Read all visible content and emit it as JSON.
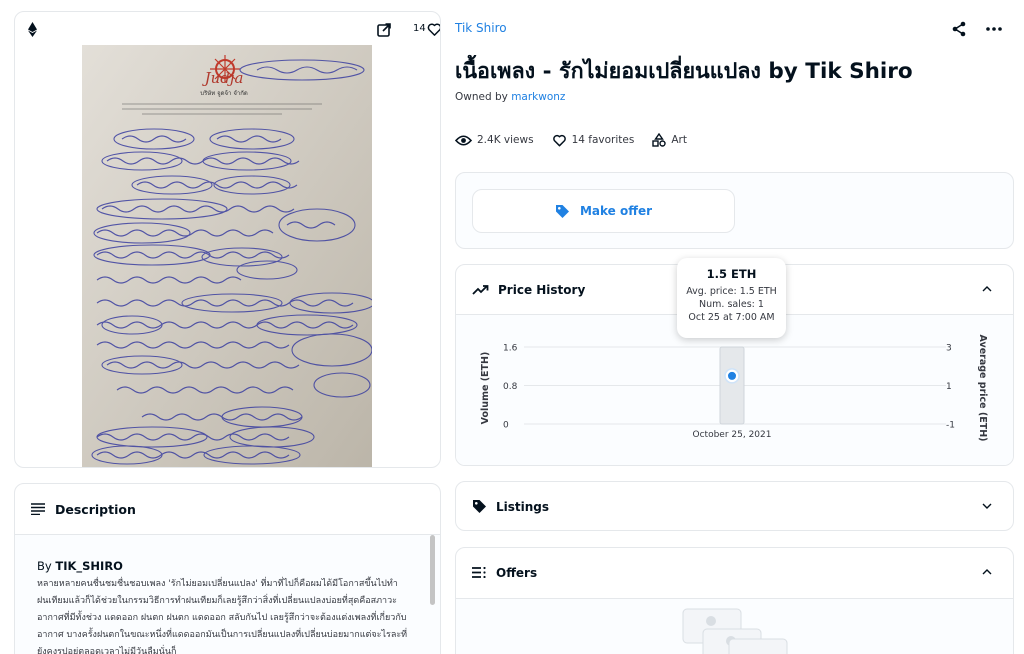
{
  "media": {
    "favorites_count": "14",
    "document": {
      "logo_text": "Judja",
      "company_name": "บริษัท จูดจ้า จำกัด"
    }
  },
  "description": {
    "heading": "Description",
    "by_prefix": "By",
    "author": "TIK_SHIRO",
    "text": "หลายหลายคนชื่นชมชื่นชอบเพลง 'รักไม่ยอมเปลี่ยนแปลง' ที่มาที่ไปก็คือผมได้มีโอกาสขึ้นไปทำฝนเทียมแล้วก็ได้ช่วยในกรรมวิธีการทำฝนเทียมก็เลยรู้สึกว่าสิ่งที่เปลี่ยนแปลงบ่อยที่สุดคือสภาวะอากาศที่มีทั้งช่วง แดดออก ฝนตก ฝนตก แดดออก สลับกันไป เลยรู้สึกว่าจะต้องแต่งเพลงที่เกี่ยวกับอากาศ บางครั้งฝนตกในขณะหนึ่งที่แดดออกมันเป็นการเปลี่ยนแปลงที่เปลี่ยนบ่อยมากแต่จะไรละที่ยังคงรูปอยู่ตลอดเวลาไม่มีวันลืมนั่นก็"
  },
  "item": {
    "collection": "Tik Shiro",
    "title": "เนื้อเพลง - รักไม่ยอมเปลี่ยนแปลง by Tik Shiro",
    "owned_by_label": "Owned by",
    "owner": "markwonz",
    "views": "2.4K views",
    "favorites": "14 favorites",
    "category": "Art"
  },
  "actions": {
    "make_offer": "Make offer"
  },
  "price_history": {
    "heading": "Price History",
    "tooltip": {
      "price": "1.5 ETH",
      "avg": "Avg. price: 1.5 ETH",
      "sales": "Num. sales: 1",
      "date": "Oct 25 at 7:00 AM"
    }
  },
  "listings": {
    "heading": "Listings"
  },
  "offers": {
    "heading": "Offers"
  },
  "colors": {
    "accent": "#2081e2",
    "text": "#04111d",
    "border": "#e5e8eb"
  },
  "chart_data": {
    "type": "bar",
    "categories": [
      "October 25, 2021"
    ],
    "series": [
      {
        "values": [
          1.6
        ]
      },
      {
        "values": [
          1.5
        ]
      }
    ],
    "ylabel": "Volume (ETH)",
    "y2label": "Average price (ETH)",
    "y_ticks": [
      "0",
      "0.8",
      "1.6"
    ],
    "y2_ticks": [
      "-1",
      "1",
      "3"
    ],
    "ylim": [
      0,
      1.6
    ],
    "y2lim": [
      -1,
      3
    ]
  }
}
